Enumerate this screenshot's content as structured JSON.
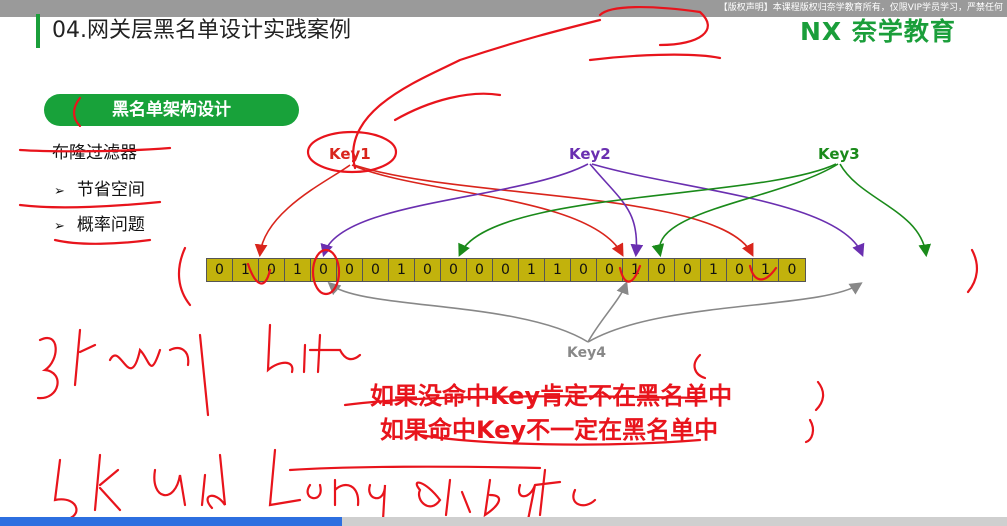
{
  "header": {
    "copyright": "【版权声明】本课程版权归奈学教育所有，仅限VIP学员学习，严禁任何",
    "title": "04.网关层黑名单设计实践案例",
    "logo": "NX 奈学教育"
  },
  "section": {
    "pill": "黑名单架构设计",
    "heading": "布隆过滤器",
    "bullets": [
      "节省空间",
      "概率问题"
    ]
  },
  "keys": {
    "key1": "Key1",
    "key2": "Key2",
    "key3": "Key3",
    "key4": "Key4"
  },
  "bits": [
    0,
    1,
    0,
    1,
    0,
    0,
    0,
    1,
    0,
    0,
    0,
    0,
    1,
    1,
    0,
    0,
    1,
    0,
    0,
    1,
    0,
    1,
    0
  ],
  "conclusion": {
    "line1": "如果没命中Key肯定不在黑名单中",
    "line2": "如果命中Key不一定在黑名单中"
  },
  "colors": {
    "accent": "#18a23a",
    "key1": "#d9251c",
    "key2": "#6a2fb0",
    "key3": "#1a8a1a",
    "key4": "#888888",
    "bit_fill": "#c2b20c",
    "annotation": "#e8141c"
  },
  "progress": {
    "fraction": 0.34
  }
}
